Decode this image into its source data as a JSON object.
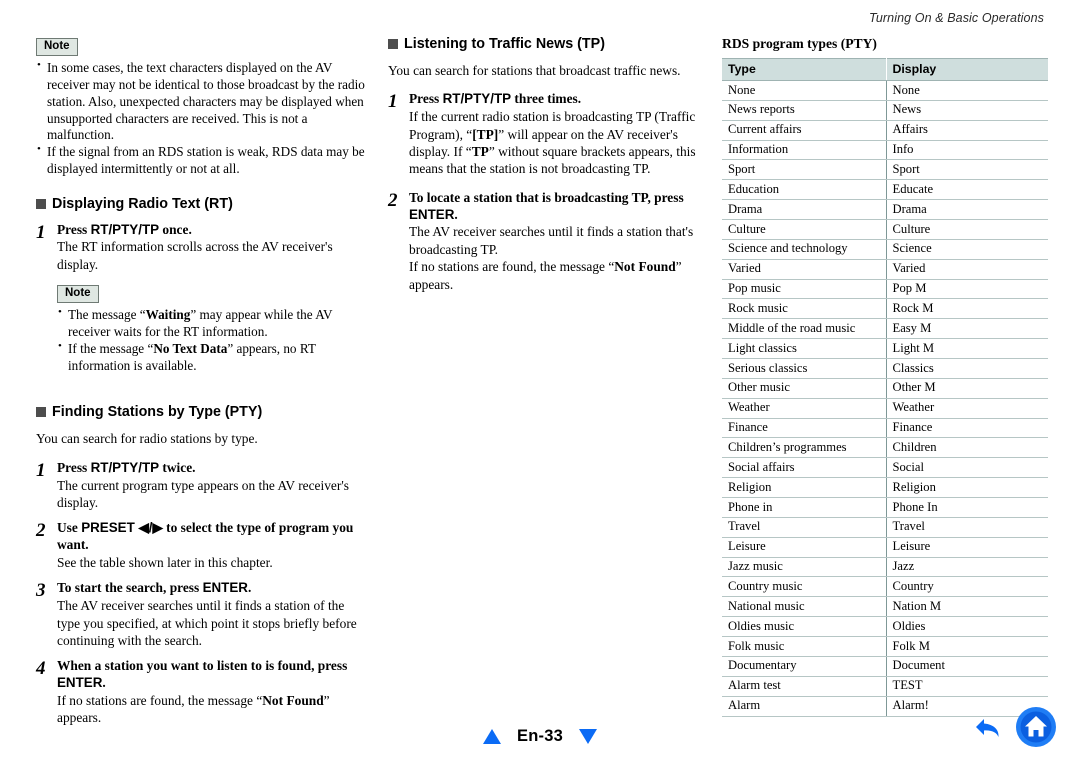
{
  "header": {
    "running_title": "Turning On & Basic Operations"
  },
  "left_column": {
    "top_note": {
      "badge": "Note",
      "items": [
        "In some cases, the text characters displayed on the AV receiver may not be identical to those broadcast by the radio station. Also, unexpected characters may be displayed when unsupported characters are received. This is not a malfunction.",
        "If the signal from an RDS station is weak, RDS data may be displayed intermittently or not at all."
      ]
    },
    "section_rt": {
      "heading": "Displaying Radio Text (RT)",
      "steps": [
        {
          "num": "1",
          "title_pre": "Press ",
          "title_sans": "RT/PTY/TP",
          "title_post": " once.",
          "text": "The RT information scrolls across the AV receiver's display."
        }
      ],
      "inner_note": {
        "badge": "Note",
        "items": [
          {
            "pre": "The message “",
            "bold": "Waiting",
            "post": "” may appear while the AV receiver waits for the RT information."
          },
          {
            "pre": "If the message “",
            "bold": "No Text Data",
            "post": "” appears, no RT information is available."
          }
        ]
      }
    },
    "section_pty": {
      "heading": "Finding Stations by Type (PTY)",
      "intro": "You can search for radio stations by type.",
      "steps": [
        {
          "num": "1",
          "title_pre": "Press ",
          "title_sans": "RT/PTY/TP",
          "title_post": " twice.",
          "text": "The current program type appears on the AV receiver's display."
        },
        {
          "num": "2",
          "title_pre": "Use ",
          "title_sans": "PRESET ◀/▶",
          "title_post": " to select the type of program you want.",
          "text": "See the table shown later in this chapter."
        },
        {
          "num": "3",
          "title_pre": "To start the search, press ",
          "title_sans": "ENTER",
          "title_post": ".",
          "text": "The AV receiver searches until it finds a station of the type you specified, at which point it stops briefly before continuing with the search."
        },
        {
          "num": "4",
          "title_pre": "When a station you want to listen to is found, press ",
          "title_sans": "ENTER",
          "title_post": ".",
          "text_pre": "If no stations are found, the message “",
          "text_bold": "Not Found",
          "text_post": "” appears."
        }
      ]
    }
  },
  "middle_column": {
    "section_tp": {
      "heading": "Listening to Traffic News (TP)",
      "intro": "You can search for stations that broadcast traffic news.",
      "step1": {
        "num": "1",
        "title_pre": "Press ",
        "title_sans": "RT/PTY/TP",
        "title_post": " three times.",
        "text_a": "If the current radio station is broadcasting TP (Traffic Program), “",
        "text_b1": "[TP]",
        "text_c": "” will appear on the AV receiver's display. If “",
        "text_b2": "TP",
        "text_d": "” without square brackets appears, this means that the station is not broadcasting TP."
      },
      "step2": {
        "num": "2",
        "title_pre": "To locate a station that is broadcasting TP, press ",
        "title_sans": "ENTER",
        "title_post": ".",
        "text_line1": "The AV receiver searches until it finds a station that's broadcasting TP.",
        "text_pre": "If no stations are found, the message “",
        "text_bold": "Not Found",
        "text_post": "” appears."
      }
    }
  },
  "right_column": {
    "table_title": "RDS program types (PTY)",
    "table": {
      "headers": [
        "Type",
        "Display"
      ],
      "rows": [
        [
          "None",
          "None"
        ],
        [
          "News reports",
          "News"
        ],
        [
          "Current affairs",
          "Affairs"
        ],
        [
          "Information",
          "Info"
        ],
        [
          "Sport",
          "Sport"
        ],
        [
          "Education",
          "Educate"
        ],
        [
          "Drama",
          "Drama"
        ],
        [
          "Culture",
          "Culture"
        ],
        [
          "Science and technology",
          "Science"
        ],
        [
          "Varied",
          "Varied"
        ],
        [
          "Pop music",
          "Pop M"
        ],
        [
          "Rock music",
          "Rock M"
        ],
        [
          "Middle of the road music",
          "Easy M"
        ],
        [
          "Light classics",
          "Light M"
        ],
        [
          "Serious classics",
          "Classics"
        ],
        [
          "Other music",
          "Other M"
        ],
        [
          "Weather",
          "Weather"
        ],
        [
          "Finance",
          "Finance"
        ],
        [
          "Children’s programmes",
          "Children"
        ],
        [
          "Social affairs",
          "Social"
        ],
        [
          "Religion",
          "Religion"
        ],
        [
          "Phone in",
          "Phone In"
        ],
        [
          "Travel",
          "Travel"
        ],
        [
          "Leisure",
          "Leisure"
        ],
        [
          "Jazz music",
          "Jazz"
        ],
        [
          "Country music",
          "Country"
        ],
        [
          "National music",
          "Nation M"
        ],
        [
          "Oldies music",
          "Oldies"
        ],
        [
          "Folk music",
          "Folk M"
        ],
        [
          "Documentary",
          "Document"
        ],
        [
          "Alarm test",
          "TEST"
        ],
        [
          "Alarm",
          "Alarm!"
        ]
      ]
    }
  },
  "footer": {
    "page_label": "En-33",
    "prev_icon": "triangle-up-icon",
    "next_icon": "triangle-down-icon",
    "back_icon": "back-arrow-icon",
    "home_icon": "home-icon",
    "accent_blue": "#0b6bf5"
  }
}
